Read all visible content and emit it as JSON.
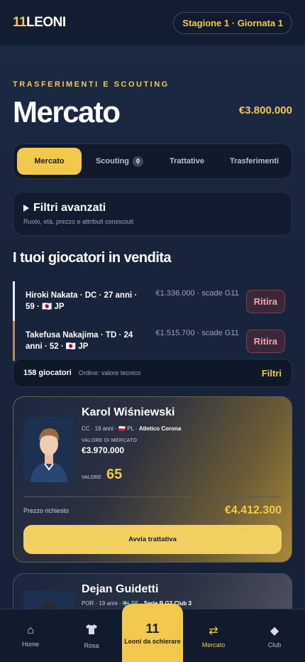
{
  "header": {
    "logo_num": "11",
    "logo_text": "LEONI",
    "season_label": "Stagione 1 · Giornata 1"
  },
  "page": {
    "eyebrow": "TRASFERIMENTI E SCOUTING",
    "title": "Mercato",
    "budget": "€3.800.000"
  },
  "tabs": [
    {
      "label": "Mercato",
      "active": true
    },
    {
      "label": "Scouting",
      "badge": "0"
    },
    {
      "label": "Trattative"
    },
    {
      "label": "Trasferimenti"
    }
  ],
  "filters": {
    "title": "Filtri avanzati",
    "subtitle": "Ruolo, età, prezzo e attributi conosciuti"
  },
  "for_sale": {
    "title": "I tuoi giocatori in vendita",
    "rows": [
      {
        "name_line1": "Hiroki Nakata · DC · 27 anni ·",
        "name_line2": "59 · 🇯🇵 JP",
        "price": "€1.336.000 · scade G11",
        "action": "Ritira"
      },
      {
        "name_line1": "Takefusa Nakajima · TD · 24",
        "name_line2": "anni · 52 · 🇯🇵 JP",
        "price": "€1.515.700 · scade G11",
        "action": "Ritira"
      }
    ]
  },
  "list_bar": {
    "count": "158 giocatori",
    "order": "Ordine: valore tecnico",
    "filter_button": "Filtri"
  },
  "players": [
    {
      "name": "Karol Wiśniewski",
      "meta": "CC · 19 anni · 🇵🇱 PL ·",
      "club": "Atletico Corona",
      "market_value_label": "VALORE DI MERCATO",
      "market_value": "€3.970.000",
      "value_label": "VALORE",
      "value": "65",
      "ask_label": "Prezzo richiesto",
      "ask_price": "€4.412.300",
      "cta": "Avvia trattativa"
    },
    {
      "name": "Dejan Guidetti",
      "meta": "POR · 19 anni · 🇸🇪 SE ·",
      "club": "Serie B G2 Club 3"
    }
  ],
  "nav": {
    "home": "Home",
    "rosa": "Rosa",
    "center_num": "11",
    "center_label": "Leoni da schierare",
    "mercato": "Mercato",
    "club": "Club"
  },
  "colors": {
    "accent": "#f2c94c",
    "background": "#1d2a44",
    "danger": "#f0a6b4"
  }
}
